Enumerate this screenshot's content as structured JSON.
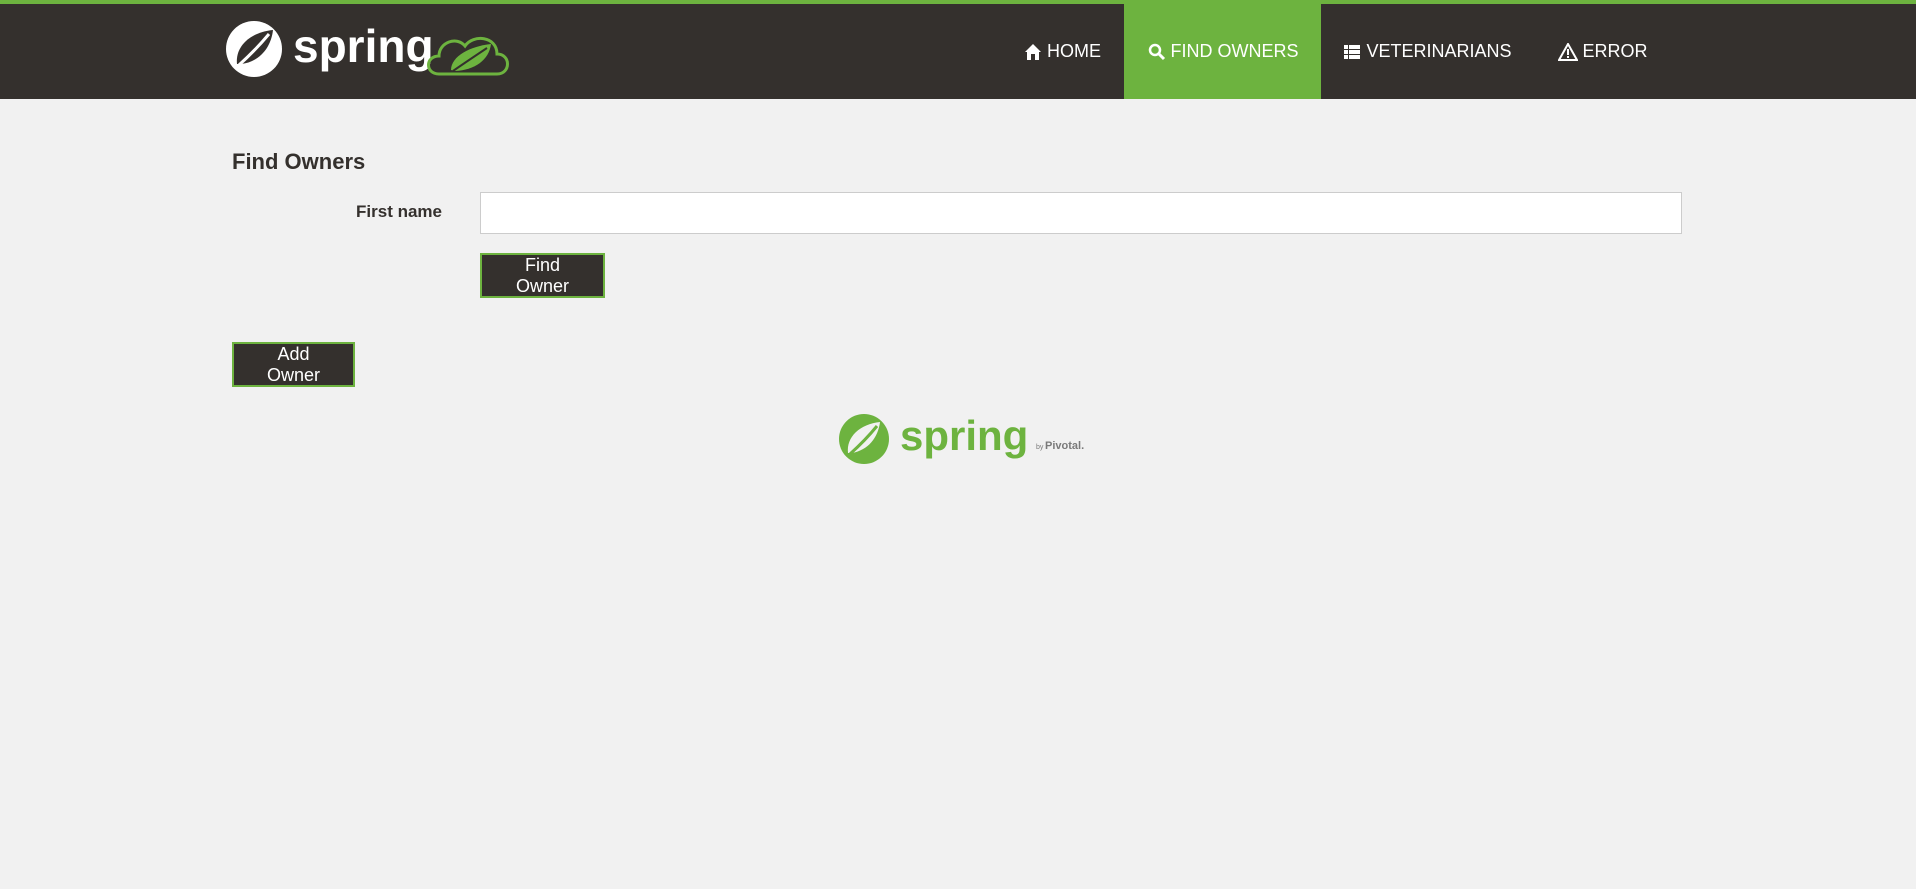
{
  "header": {
    "brand_word": "spring",
    "nav": [
      {
        "label": "HOME",
        "icon": "home-icon"
      },
      {
        "label": "FIND OWNERS",
        "icon": "search-icon",
        "active": true
      },
      {
        "label": "VETERINARIANS",
        "icon": "list-icon"
      },
      {
        "label": "ERROR",
        "icon": "warning-icon"
      }
    ]
  },
  "main": {
    "title": "Find Owners",
    "first_name_label": "First name",
    "first_name_value": "",
    "find_button": "Find Owner",
    "add_button": "Add Owner"
  },
  "footer": {
    "brand_word": "spring",
    "by_text": "by",
    "company": "Pivotal."
  },
  "colors": {
    "accent": "#6db33f",
    "dark": "#34302d",
    "background": "#f1f1f1"
  }
}
